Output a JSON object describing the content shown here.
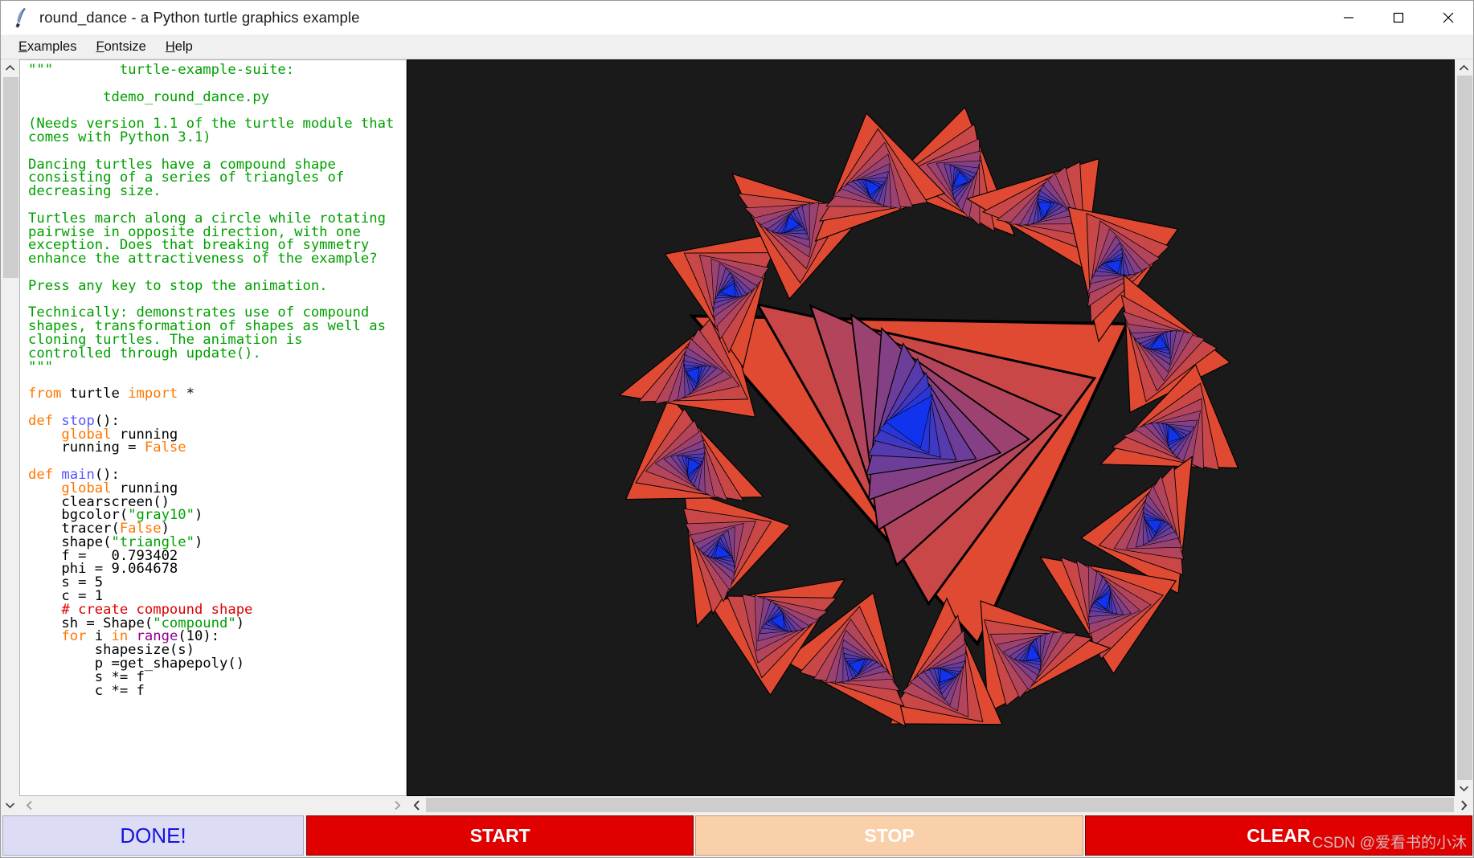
{
  "window": {
    "title": "round_dance - a Python turtle graphics example",
    "icon": "python-feather-icon",
    "controls": {
      "minimize": "minimize-icon",
      "maximize": "maximize-icon",
      "close": "close-icon"
    }
  },
  "menubar": {
    "items": [
      {
        "label": "Examples",
        "mnemonic": "E"
      },
      {
        "label": "Fontsize",
        "mnemonic": "F"
      },
      {
        "label": "Help",
        "mnemonic": "H"
      }
    ]
  },
  "editor": {
    "language": "python",
    "filename": "tdemo_round_dance.py",
    "lines": [
      [
        {
          "t": "\"\"\"        turtle-example-suite:",
          "c": "s-str"
        }
      ],
      [
        {
          "t": "",
          "c": "s-str"
        }
      ],
      [
        {
          "t": "         tdemo_round_dance.py",
          "c": "s-str"
        }
      ],
      [
        {
          "t": "",
          "c": "s-str"
        }
      ],
      [
        {
          "t": "(Needs version 1.1 of the turtle module that",
          "c": "s-str"
        }
      ],
      [
        {
          "t": "comes with Python 3.1)",
          "c": "s-str"
        }
      ],
      [
        {
          "t": "",
          "c": "s-str"
        }
      ],
      [
        {
          "t": "Dancing turtles have a compound shape",
          "c": "s-str"
        }
      ],
      [
        {
          "t": "consisting of a series of triangles of",
          "c": "s-str"
        }
      ],
      [
        {
          "t": "decreasing size.",
          "c": "s-str"
        }
      ],
      [
        {
          "t": "",
          "c": "s-str"
        }
      ],
      [
        {
          "t": "Turtles march along a circle while rotating",
          "c": "s-str"
        }
      ],
      [
        {
          "t": "pairwise in opposite direction, with one",
          "c": "s-str"
        }
      ],
      [
        {
          "t": "exception. Does that breaking of symmetry",
          "c": "s-str"
        }
      ],
      [
        {
          "t": "enhance the attractiveness of the example?",
          "c": "s-str"
        }
      ],
      [
        {
          "t": "",
          "c": "s-str"
        }
      ],
      [
        {
          "t": "Press any key to stop the animation.",
          "c": "s-str"
        }
      ],
      [
        {
          "t": "",
          "c": "s-str"
        }
      ],
      [
        {
          "t": "Technically: demonstrates use of compound",
          "c": "s-str"
        }
      ],
      [
        {
          "t": "shapes, transformation of shapes as well as",
          "c": "s-str"
        }
      ],
      [
        {
          "t": "cloning turtles. The animation is",
          "c": "s-str"
        }
      ],
      [
        {
          "t": "controlled through update().",
          "c": "s-str"
        }
      ],
      [
        {
          "t": "\"\"\"",
          "c": "s-str"
        }
      ],
      [
        {
          "t": "",
          "c": "s-txt"
        }
      ],
      [
        {
          "t": "from ",
          "c": "s-kw"
        },
        {
          "t": "turtle ",
          "c": "s-txt"
        },
        {
          "t": "import ",
          "c": "s-kw"
        },
        {
          "t": "*",
          "c": "s-txt"
        }
      ],
      [
        {
          "t": "",
          "c": "s-txt"
        }
      ],
      [
        {
          "t": "def ",
          "c": "s-kw"
        },
        {
          "t": "stop",
          "c": "s-def"
        },
        {
          "t": "():",
          "c": "s-txt"
        }
      ],
      [
        {
          "t": "    ",
          "c": "s-txt"
        },
        {
          "t": "global ",
          "c": "s-kw"
        },
        {
          "t": "running",
          "c": "s-txt"
        }
      ],
      [
        {
          "t": "    running = ",
          "c": "s-txt"
        },
        {
          "t": "False",
          "c": "s-kw"
        }
      ],
      [
        {
          "t": "",
          "c": "s-txt"
        }
      ],
      [
        {
          "t": "def ",
          "c": "s-kw"
        },
        {
          "t": "main",
          "c": "s-def"
        },
        {
          "t": "():",
          "c": "s-txt"
        }
      ],
      [
        {
          "t": "    ",
          "c": "s-txt"
        },
        {
          "t": "global ",
          "c": "s-kw"
        },
        {
          "t": "running",
          "c": "s-txt"
        }
      ],
      [
        {
          "t": "    clearscreen()",
          "c": "s-txt"
        }
      ],
      [
        {
          "t": "    bgcolor(",
          "c": "s-txt"
        },
        {
          "t": "\"gray10\"",
          "c": "s-str"
        },
        {
          "t": ")",
          "c": "s-txt"
        }
      ],
      [
        {
          "t": "    tracer(",
          "c": "s-txt"
        },
        {
          "t": "False",
          "c": "s-kw"
        },
        {
          "t": ")",
          "c": "s-txt"
        }
      ],
      [
        {
          "t": "    shape(",
          "c": "s-txt"
        },
        {
          "t": "\"triangle\"",
          "c": "s-str"
        },
        {
          "t": ")",
          "c": "s-txt"
        }
      ],
      [
        {
          "t": "    f =   0.793402",
          "c": "s-txt"
        }
      ],
      [
        {
          "t": "    phi = 9.064678",
          "c": "s-txt"
        }
      ],
      [
        {
          "t": "    s = 5",
          "c": "s-txt"
        }
      ],
      [
        {
          "t": "    c = 1",
          "c": "s-txt"
        }
      ],
      [
        {
          "t": "    ",
          "c": "s-txt"
        },
        {
          "t": "# create compound shape",
          "c": "s-com"
        }
      ],
      [
        {
          "t": "    sh = Shape(",
          "c": "s-txt"
        },
        {
          "t": "\"compound\"",
          "c": "s-str"
        },
        {
          "t": ")",
          "c": "s-txt"
        }
      ],
      [
        {
          "t": "    ",
          "c": "s-txt"
        },
        {
          "t": "for ",
          "c": "s-kw"
        },
        {
          "t": "i ",
          "c": "s-txt"
        },
        {
          "t": "in ",
          "c": "s-kw"
        },
        {
          "t": "range",
          "c": "s-bi"
        },
        {
          "t": "(10):",
          "c": "s-txt"
        }
      ],
      [
        {
          "t": "        shapesize(s)",
          "c": "s-txt"
        }
      ],
      [
        {
          "t": "        p =get_shapepoly()",
          "c": "s-txt"
        }
      ],
      [
        {
          "t": "        s *= f",
          "c": "s-txt"
        }
      ],
      [
        {
          "t": "        c *= f",
          "c": "s-txt"
        }
      ]
    ],
    "scrollbars": {
      "vertical_up": "chevron-up-icon",
      "vertical_down": "chevron-down-icon",
      "horizontal_left": "chevron-left-icon",
      "horizontal_right": "chevron-right-icon"
    }
  },
  "canvas": {
    "background_color": "#1a1a1a",
    "description": "turtle round dance animation",
    "scrollbars": {
      "up": "chevron-up-icon",
      "down": "chevron-down-icon",
      "left": "chevron-left-icon",
      "right": "chevron-right-icon"
    },
    "graphic": {
      "ring_turtle_count": 17,
      "nested_triangles_per_turtle": 10,
      "color_start": "#e04a32",
      "color_end": "#1133ee",
      "outline_color": "#000000"
    }
  },
  "buttons": {
    "done": {
      "label": "DONE!",
      "color": "#1414dc",
      "background": "#dcdcf5",
      "enabled": true
    },
    "start": {
      "label": "START",
      "color": "#ffffff",
      "background": "#e00000",
      "enabled": true
    },
    "stop": {
      "label": "STOP",
      "color": "#ffffff",
      "background": "#fad0aa",
      "enabled": false
    },
    "clear": {
      "label": "CLEAR",
      "color": "#ffffff",
      "background": "#e00000",
      "enabled": true
    }
  },
  "watermark": {
    "text": "CSDN @爱看书的小沐"
  }
}
